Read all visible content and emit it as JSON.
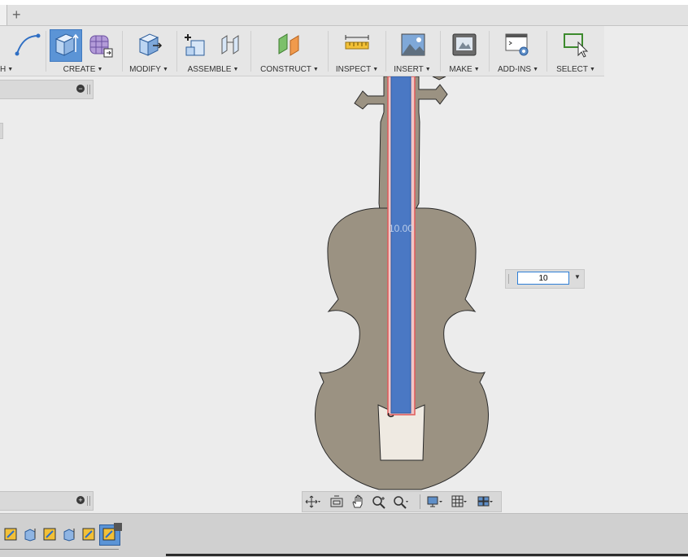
{
  "tabs": {
    "add_tab": "+"
  },
  "toolbar": {
    "sketch_partial_label": "H",
    "groups": [
      {
        "label": "CREATE"
      },
      {
        "label": "MODIFY"
      },
      {
        "label": "ASSEMBLE"
      },
      {
        "label": "CONSTRUCT"
      },
      {
        "label": "INSPECT"
      },
      {
        "label": "INSERT"
      },
      {
        "label": "MAKE"
      },
      {
        "label": "ADD-INS"
      },
      {
        "label": "SELECT"
      }
    ]
  },
  "panels": {
    "browser_collapse": "−",
    "comments_expand": "+"
  },
  "canvas": {
    "dimension_overlay": "10.00"
  },
  "dimension_input": {
    "value": "10"
  },
  "colors": {
    "body_fill": "#9b9282",
    "selected_face": "#4a78c4",
    "selection_outline": "#e05a5a",
    "bridge_fill": "#efeae2"
  }
}
